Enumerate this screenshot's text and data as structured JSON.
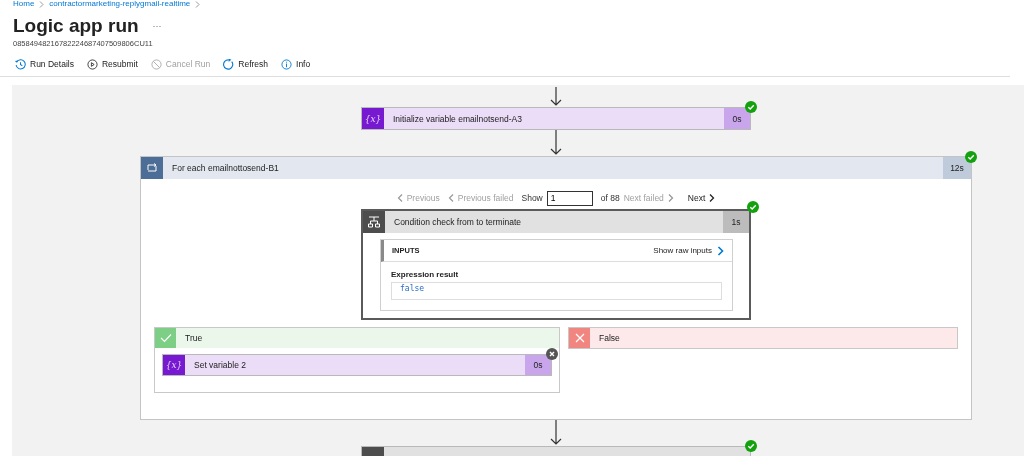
{
  "breadcrumb": [
    {
      "label": "Home"
    },
    {
      "label": "contractormarketing-replygmail-realtime"
    }
  ],
  "title": "Logic app run",
  "more_label": "···",
  "run_id": "08584948216782224687407509806CU11",
  "toolbar": [
    {
      "kind": "details",
      "label": "Run Details",
      "disabled": false
    },
    {
      "kind": "resubmit",
      "label": "Resubmit",
      "disabled": false
    },
    {
      "kind": "cancel",
      "label": "Cancel Run",
      "disabled": true
    },
    {
      "kind": "refresh",
      "label": "Refresh",
      "disabled": false
    },
    {
      "kind": "info",
      "label": "Info",
      "disabled": false
    }
  ],
  "init_step": {
    "kind": "variable",
    "icon_label": "{x}",
    "title": "Initialize variable emailnotsend-A3",
    "duration": "0s",
    "succeeded": true
  },
  "foreach": {
    "title": "For each emailnottosend-B1",
    "duration": "12s",
    "succeeded": true,
    "pager": {
      "back": [
        {
          "label": "Previous",
          "disabled": true
        },
        {
          "label": "Previous failed",
          "disabled": true
        }
      ],
      "show_label": "Show",
      "value": "1",
      "of_label": "of 88",
      "forward": [
        {
          "label": "Next failed",
          "disabled": true
        },
        {
          "label": "Next",
          "disabled": false
        }
      ]
    },
    "condition": {
      "title": "Condition check from to terminate",
      "duration": "1s",
      "succeeded": true,
      "inputs_label": "INPUTS",
      "raw_link": "Show raw inputs",
      "field_label": "Expression result",
      "field_value": "false"
    },
    "branches": [
      {
        "kind": "true",
        "label": "True",
        "steps": [
          {
            "kind": "variable",
            "icon_label": "{x}",
            "title": "Set variable 2",
            "duration": "0s",
            "succeeded": false
          }
        ]
      },
      {
        "kind": "false",
        "label": "False"
      }
    ]
  },
  "next_step": {
    "kind": "condition",
    "succeeded": true
  }
}
